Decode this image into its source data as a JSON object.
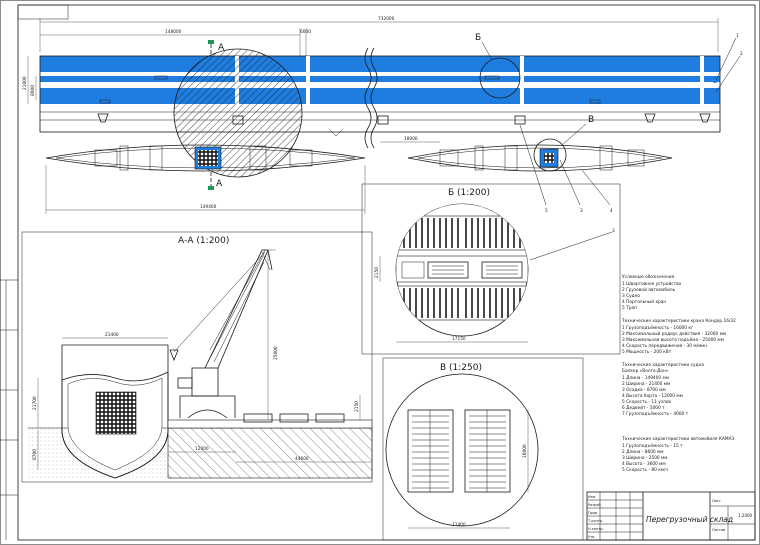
{
  "colors": {
    "accent": "#1f7de0",
    "line": "#1a1a1a",
    "paper": "#ffffff"
  },
  "dimensions": {
    "total_length": "732000",
    "left_span": "148000",
    "small_top": "6000",
    "height_left_outer": "21000",
    "height_left_inner": "8000",
    "bottom_length": "149400",
    "bottom_right": "18000",
    "bb_width": "17150",
    "bb_height": "2150",
    "aa_deck": "21400",
    "aa_side": "21700",
    "aa_draft": "8700",
    "aa_crane_h": "25000",
    "aa_span": "44600",
    "aa_berth": "12000",
    "aa_pier": "2150",
    "vv_height": "16000",
    "vv_width": "11400"
  },
  "markers": {
    "section_a": "А",
    "callout_b": "Б",
    "callout_v": "В",
    "callout_1": "1",
    "callout_2": "2",
    "callout_3": "3",
    "callout_4": "4",
    "callout_5": "5"
  },
  "views": {
    "section_aa": "А-А (1:200)",
    "detail_b": "Б (1:200)",
    "detail_v": "В (1:250)"
  },
  "notes": {
    "legend_heading": "Условные обозначения",
    "legend": [
      "1 Швартовное устройство",
      "2 Грузовой автомобиль",
      "3 Судно",
      "4 Портальный кран",
      "5 Трап"
    ],
    "crane_heading": "Технические характеристики крана Кондор 16/32",
    "crane": [
      "1 Грузоподъёмность - 16000 кг",
      "2 Максимальный радиус действия - 32000 мм",
      "3 Максимальная высота подъёма - 25000 мм",
      "4 Скорость передвижения - 30 м/мин",
      "5 Мощность - 200 кВт"
    ],
    "vessel_heading": "Технические характеристики судна",
    "vessel_sub": "Балкер «Волго-Дон»",
    "vessel": [
      "1 Длина - 149400 мм",
      "2 Ширина - 21400 мм",
      "3 Осадка - 8700 мм",
      "4 Высота борта - 12000 мм",
      "5 Скорость - 11 узлов",
      "6 Дедвейт - 5000 т",
      "7 Грузоподъёмность - 4000 т"
    ],
    "truck_heading": "Технические характеристики автомобиля КАМАЗ",
    "truck": [
      "1 Грузоподъёмность - 15 т",
      "2 Длина - 8600 мм",
      "3 Ширина - 2500 мм",
      "4 Высота - 3600 мм",
      "5 Скорость - 80 км/ч"
    ]
  },
  "title_block": {
    "title": "Перегрузочный склад",
    "sheet": "Лист",
    "sheets": "Листов",
    "scale": "1:2000",
    "rows": [
      "Изм",
      "Разраб.",
      "Пров.",
      "Т.контр.",
      "Н.контр.",
      "Утв."
    ]
  }
}
